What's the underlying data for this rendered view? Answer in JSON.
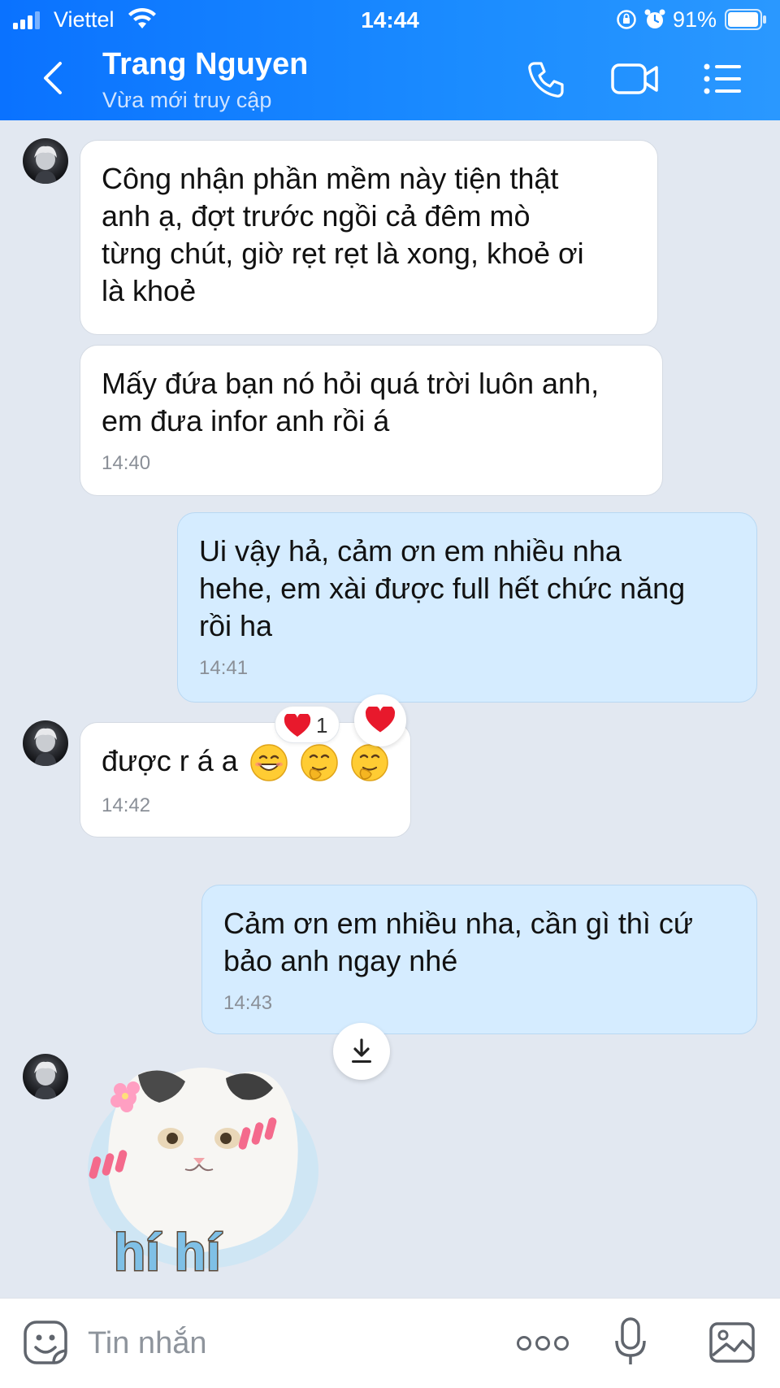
{
  "status_bar": {
    "carrier": "Viettel",
    "time": "14:44",
    "battery_percent": "91%"
  },
  "header": {
    "contact_name": "Trang Nguyen",
    "contact_status": "Vừa mới truy cập"
  },
  "messages": [
    {
      "direction": "incoming",
      "text": "Công nhận phần mềm này tiện thật\nanh ạ, đợt trước ngồi cả đêm mò\ntừng chút, giờ rẹt rẹt là xong, khoẻ ơi\nlà khoẻ",
      "time": ""
    },
    {
      "direction": "incoming",
      "text": "Mấy đứa bạn nó hỏi quá trời luôn anh,\nem đưa infor anh rồi á",
      "time": "14:40"
    },
    {
      "direction": "outgoing",
      "text": "Ui vậy hả, cảm ơn em nhiều nha\nhehe, em xài được full hết chức năng\nrồi ha",
      "time": "14:41"
    },
    {
      "direction": "incoming",
      "text": "được r á a",
      "time": "14:42",
      "emojis": [
        "grinning-face-emoji",
        "hugging-face-emoji",
        "hugging-face-emoji"
      ],
      "reaction": {
        "icon": "heart-icon",
        "count": "1"
      }
    },
    {
      "direction": "outgoing",
      "text": "Cảm ơn em nhiều nha, cần gì thì cứ\nbảo anh ngay nhé",
      "time": "14:43"
    }
  ],
  "sticker": {
    "caption": "hí hí"
  },
  "composer": {
    "placeholder": "Tin nhắn"
  },
  "colors": {
    "header_blue": "#0a72ff",
    "outgoing_bubble": "#d5ecff",
    "chat_background": "#e2e8f1",
    "heart_red": "#e8192c"
  }
}
